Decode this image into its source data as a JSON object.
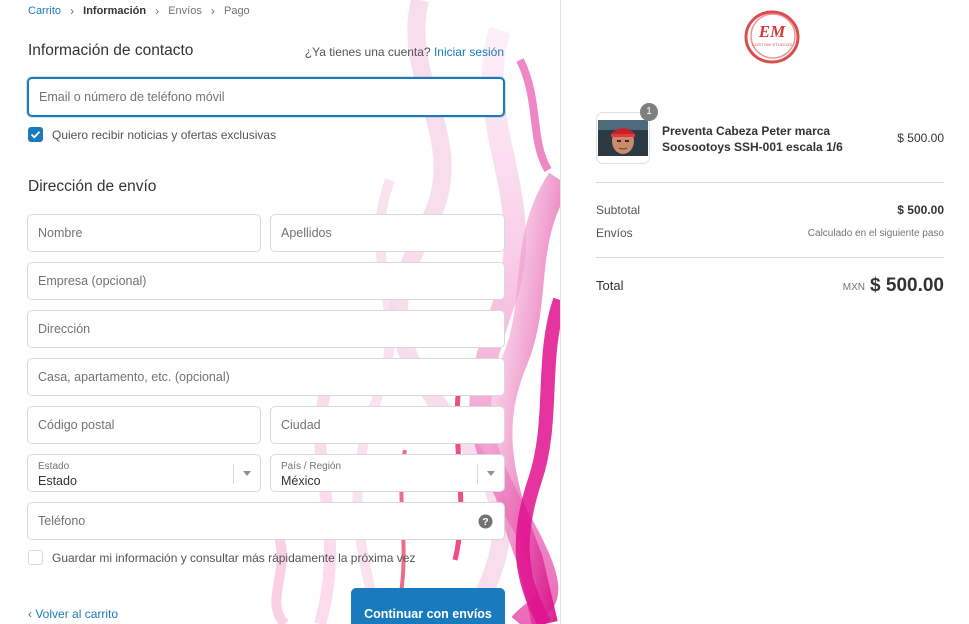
{
  "breadcrumb": {
    "items": [
      "Carrito",
      "Información",
      "Envíos",
      "Pago"
    ]
  },
  "contact": {
    "title": "Información de contacto",
    "account_prompt": "¿Ya tienes una cuenta?",
    "login_link": "Iniciar sesión",
    "email_placeholder": "Email o número de teléfono móvil",
    "newsletter_label": "Quiero recibir noticias y ofertas exclusivas",
    "newsletter_checked": true
  },
  "shipping": {
    "title": "Dirección de envío",
    "first_name_placeholder": "Nombre",
    "last_name_placeholder": "Apellidos",
    "company_placeholder": "Empresa (opcional)",
    "address_placeholder": "Dirección",
    "apartment_placeholder": "Casa, apartamento, etc. (opcional)",
    "postal_placeholder": "Código postal",
    "city_placeholder": "Ciudad",
    "state_label": "Estado",
    "state_value": "Estado",
    "country_label": "País / Región",
    "country_value": "México",
    "phone_placeholder": "Teléfono",
    "save_info_label": "Guardar mi información y consultar más rápidamente la próxima vez",
    "save_info_checked": false
  },
  "footer": {
    "back_link": "Volver al carrito",
    "continue_button": "Continuar con envíos"
  },
  "summary": {
    "logo_text": "EM",
    "logo_subtext": "CUSTOM STUDIOS",
    "item": {
      "quantity": "1",
      "name_line1": "Preventa Cabeza Peter marca",
      "name_line2": "Soosootoys SSH-001 escala 1/6",
      "price": "$ 500.00"
    },
    "subtotal_label": "Subtotal",
    "subtotal_value": "$ 500.00",
    "shipping_label": "Envíos",
    "shipping_value": "Calculado en el siguiente paso",
    "total_label": "Total",
    "currency": "MXN",
    "total_value": "$ 500.00"
  },
  "colors": {
    "accent": "#197bbd",
    "logo_red": "#d63a3a",
    "art_magenta": "#e0108f"
  }
}
